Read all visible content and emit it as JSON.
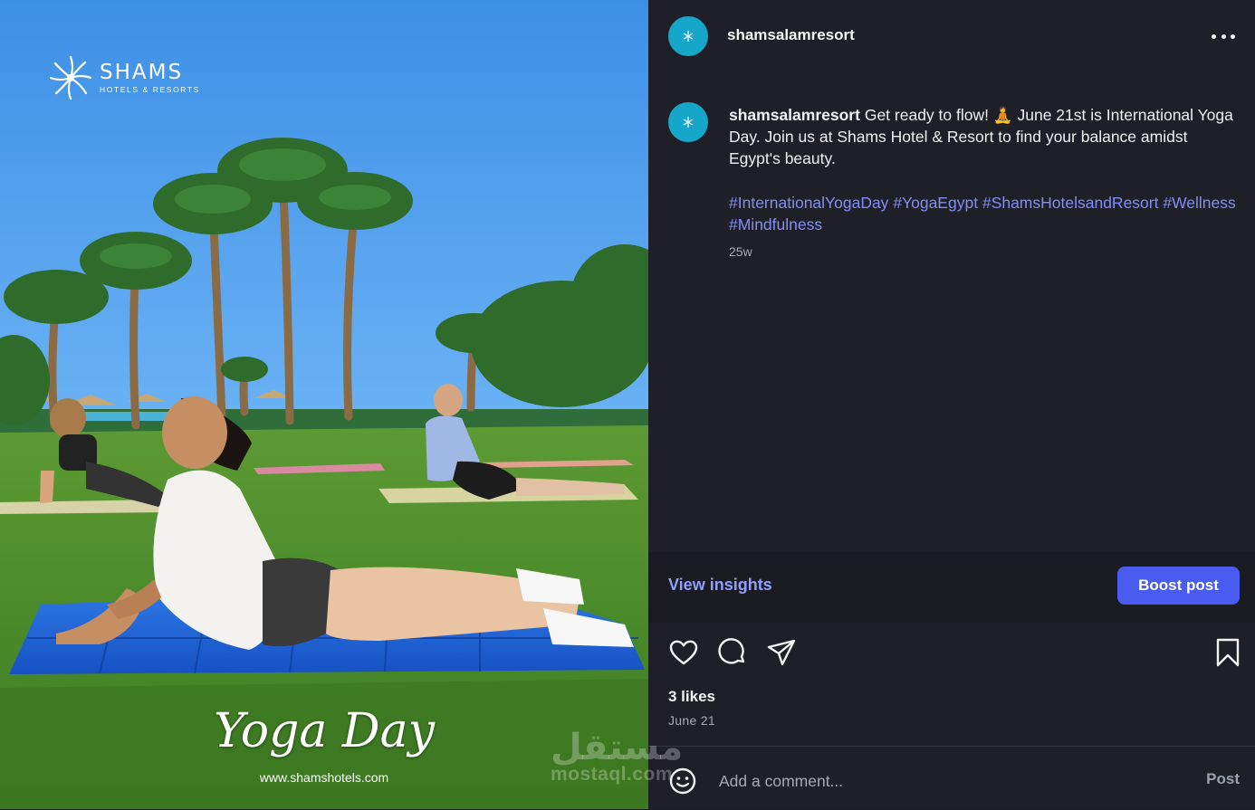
{
  "photo": {
    "brand_name": "SHAMS",
    "brand_sub": "HOTELS & RESORTS",
    "title": "Yoga Day",
    "url": "www.shamshotels.com"
  },
  "header": {
    "username": "shamsalamresort"
  },
  "caption": {
    "username": "shamsalamresort",
    "text": "Get ready to flow! 🧘 June 21st is International Yoga Day. Join us at Shams Hotel & Resort to find your balance amidst Egypt's beauty.",
    "hashtags": [
      "#InternationalYogaDay",
      "#YogaEgypt",
      "#ShamsHotelsandResort",
      "#Wellness",
      "#Mindfulness"
    ],
    "age": "25w"
  },
  "actions": {
    "insights_label": "View insights",
    "boost_label": "Boost post"
  },
  "stats": {
    "likes": "3 likes",
    "date": "June 21"
  },
  "comment": {
    "placeholder": "Add a comment...",
    "post_label": "Post"
  },
  "watermark": {
    "arabic": "مستقل",
    "latin": "mostaql.com"
  },
  "colors": {
    "panel_bg": "#1f2027",
    "link_blue": "#8f9eff",
    "hashtag_blue": "#7f8ff7",
    "boost_bg": "#4a5cf0",
    "avatar_bg": "#16a6c9"
  },
  "icons": [
    "heart-icon",
    "comment-icon",
    "share-icon",
    "bookmark-icon",
    "emoji-icon",
    "more-options-icon"
  ]
}
